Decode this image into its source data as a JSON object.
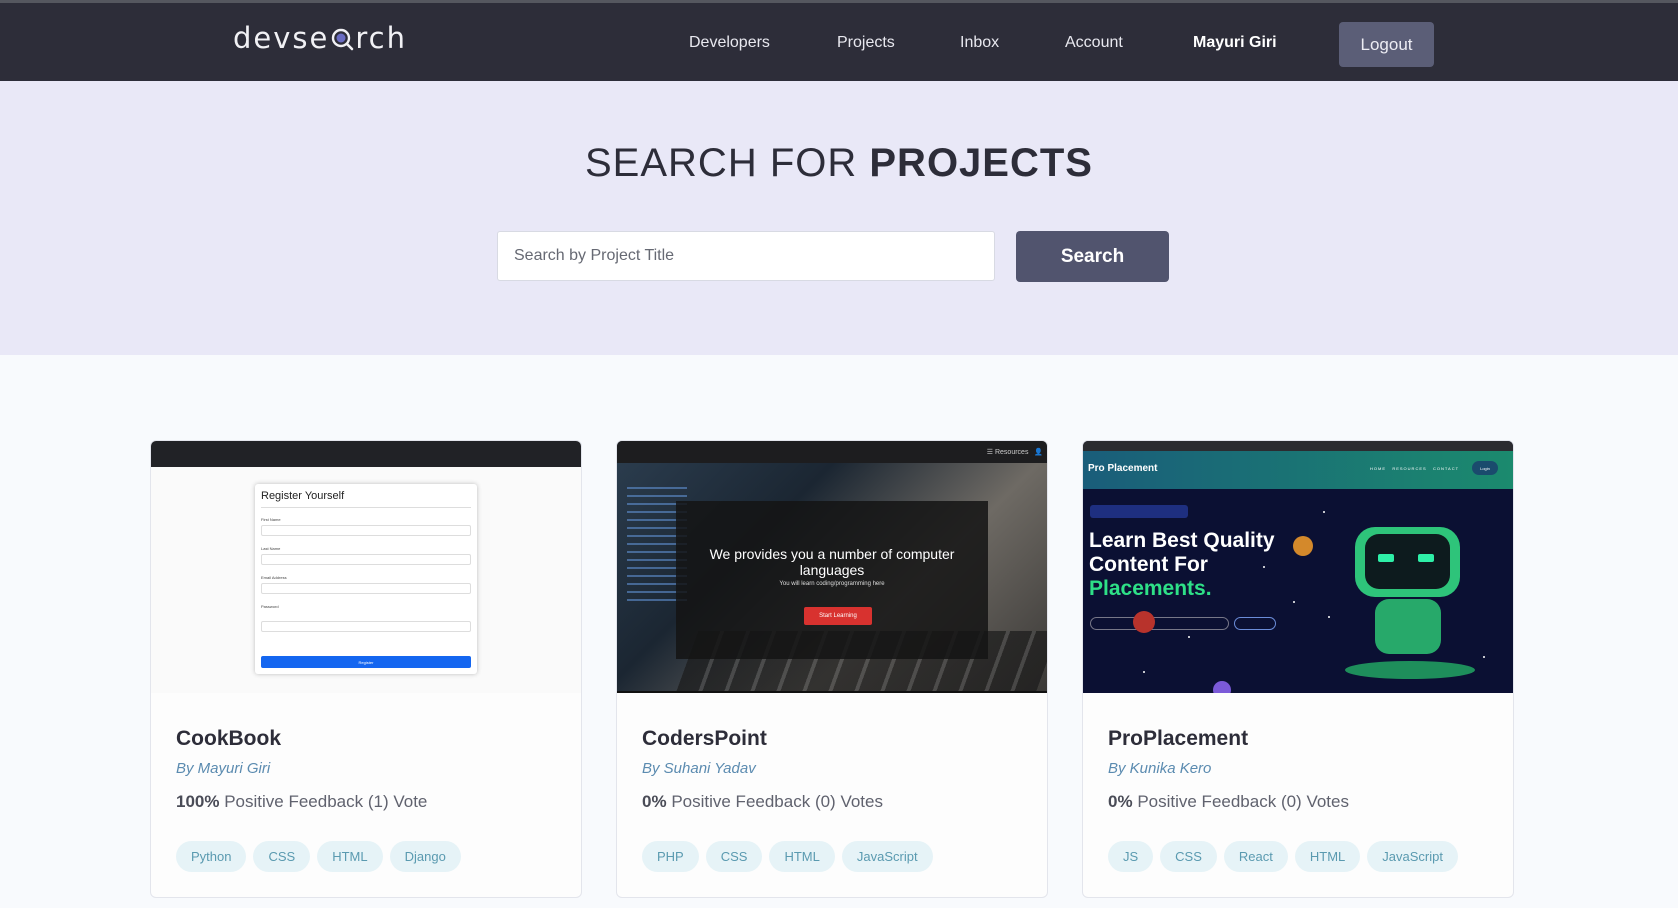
{
  "header": {
    "logo": "devsearch",
    "nav": [
      "Developers",
      "Projects",
      "Inbox",
      "Account"
    ],
    "user": "Mayuri Giri",
    "logout": "Logout"
  },
  "hero": {
    "title_light": "SEARCH FOR",
    "title_bold": "PROJECTS",
    "search_placeholder": "Search by Project Title",
    "search_button": "Search"
  },
  "projects": [
    {
      "title": "CookBook",
      "author": "By Mayuri Giri",
      "feedback_pct": "100%",
      "feedback_text": "Positive Feedback (1) Vote",
      "tags": [
        "Python",
        "CSS",
        "HTML",
        "Django"
      ],
      "thumb": {
        "form_title": "Register Yourself"
      }
    },
    {
      "title": "CodersPoint",
      "author": "By Suhani Yadav",
      "feedback_pct": "0%",
      "feedback_text": "Positive Feedback (0) Votes",
      "tags": [
        "PHP",
        "CSS",
        "HTML",
        "JavaScript"
      ],
      "thumb": {
        "heading": "We provides you a number of computer languages",
        "sub": "You will learn coding/programming here",
        "button": "Start Learning"
      }
    },
    {
      "title": "ProPlacement",
      "author": "By Kunika Kero",
      "feedback_pct": "0%",
      "feedback_text": "Positive Feedback (0) Votes",
      "tags": [
        "JS",
        "CSS",
        "React",
        "HTML",
        "JavaScript"
      ],
      "thumb": {
        "brand": "Pro Placement",
        "line1": "Learn Best Quality",
        "line2": "Content For",
        "line3": "Placements.",
        "login": "Login"
      }
    }
  ],
  "colors": {
    "header_bg": "#2d2d39",
    "hero_bg": "#e9e8f7",
    "button_bg": "#51546e",
    "tag_bg": "#e6f3f7",
    "tag_text": "#5a9ab0",
    "author_text": "#5b8bb0"
  }
}
